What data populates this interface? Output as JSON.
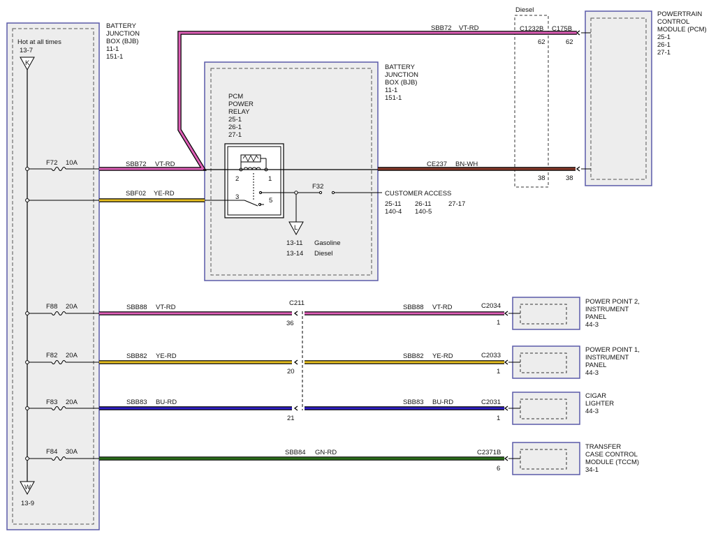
{
  "bjb_left": {
    "title_lines": [
      "BATTERY",
      "JUNCTION",
      "BOX (BJB)",
      "11-1",
      "151-1"
    ],
    "hot_label": "Hot at all times",
    "hot_ref": "13-7",
    "top_symbol": "K",
    "bottom_symbol": "W",
    "bottom_ref": "13-9"
  },
  "bjb_inner": {
    "title_lines": [
      "BATTERY",
      "JUNCTION",
      "BOX (BJB)",
      "11-1",
      "151-1"
    ],
    "relay_lines": [
      "PCM",
      "POWER",
      "RELAY",
      "25-1",
      "26-1",
      "27-1"
    ],
    "pin_2": "2",
    "pin_1": "1",
    "pin_3": "3",
    "pin_5": "5",
    "fuse_f32": "F32",
    "customer_access": "CUSTOMER ACCESS",
    "ca_refs_row1": [
      "25-11",
      "26-11",
      "27-17"
    ],
    "ca_refs_row2": [
      "140-4",
      "140-5"
    ],
    "ground_symbol": "L",
    "ground_refs": [
      {
        "ref": "13-11",
        "label": "Gasoline"
      },
      {
        "ref": "13-14",
        "label": "Diesel"
      }
    ]
  },
  "pcm": {
    "title_lines": [
      "POWERTRAIN",
      "CONTROL",
      "MODULE (PCM)",
      "25-1",
      "26-1",
      "27-1"
    ],
    "connector": "C175B",
    "pin_top": "62",
    "pin_bottom": "38"
  },
  "diesel_connector": {
    "label": "Diesel",
    "connector": "C1232B",
    "pin_top": "62",
    "pin_bottom": "38"
  },
  "wires": {
    "sbb72_top": {
      "circuit": "SBB72",
      "color": "VT-RD"
    },
    "sbb72_left": {
      "circuit": "SBB72",
      "color": "VT-RD"
    },
    "sbf02": {
      "circuit": "SBF02",
      "color": "YE-RD"
    },
    "ce237": {
      "circuit": "CE237",
      "color": "BN-WH"
    },
    "sbb88_left": {
      "circuit": "SBB88",
      "color": "VT-RD"
    },
    "sbb88_right": {
      "circuit": "SBB88",
      "color": "VT-RD"
    },
    "sbb82_left": {
      "circuit": "SBB82",
      "color": "YE-RD"
    },
    "sbb82_right": {
      "circuit": "SBB82",
      "color": "YE-RD"
    },
    "sbb83_left": {
      "circuit": "SBB83",
      "color": "BU-RD"
    },
    "sbb83_right": {
      "circuit": "SBB83",
      "color": "BU-RD"
    },
    "sbb84": {
      "circuit": "SBB84",
      "color": "GN-RD"
    }
  },
  "fuses": [
    {
      "id": "F72",
      "rating": "10A"
    },
    {
      "id": "F88",
      "rating": "20A"
    },
    {
      "id": "F82",
      "rating": "20A"
    },
    {
      "id": "F83",
      "rating": "20A"
    },
    {
      "id": "F84",
      "rating": "30A"
    }
  ],
  "inline_connector": {
    "id": "C211",
    "pins": [
      "36",
      "20",
      "21"
    ]
  },
  "components": [
    {
      "connector": "C2034",
      "pin": "1",
      "title_lines": [
        "POWER POINT 2,",
        "INSTRUMENT",
        "PANEL",
        "44-3"
      ]
    },
    {
      "connector": "C2033",
      "pin": "1",
      "title_lines": [
        "POWER POINT 1,",
        "INSTRUMENT",
        "PANEL",
        "44-3"
      ]
    },
    {
      "connector": "C2031",
      "pin": "1",
      "title_lines": [
        "CIGAR",
        "LIGHTER",
        "44-3"
      ]
    },
    {
      "connector": "C2371B",
      "pin": "6",
      "title_lines": [
        "TRANSFER",
        "CASE CONTROL",
        "MODULE (TCCM)",
        "34-1"
      ]
    }
  ],
  "colors": {
    "violet": "#e060b8",
    "yellow": "#e8c020",
    "blue": "#3020c8",
    "green": "#2a6a1a",
    "brown": "#8a3a2a",
    "box_border": "#5a5aa8",
    "box_fill": "#ededed"
  }
}
